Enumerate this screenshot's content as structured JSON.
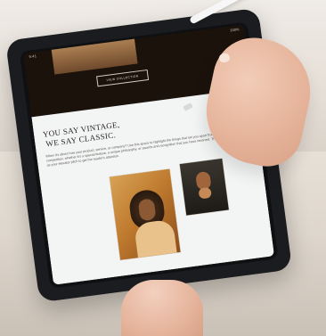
{
  "screen": {
    "status_time": "9:41",
    "status_battery": "100%",
    "cta_label": "VIEW COLLECTION",
    "headline_line1": "YOU SAY VINTAGE,",
    "headline_line2": "WE SAY CLASSIC.",
    "paragraph": "When it's about how your product, service, or company? Use this space to highlight the things that set you apart from your competition, whether it's a special feature, a unique philosophy, or awards and recognition that you have received. Think of this as your elevator pitch to get the reader's attention."
  },
  "colors": {
    "background": "#eef0f3",
    "tablet_bezel": "#1a1c1f",
    "screen_dark": "#1b120c",
    "screen_light": "#f3f5f5",
    "pencil": "#ffffff",
    "skin": "#e6b49b"
  }
}
